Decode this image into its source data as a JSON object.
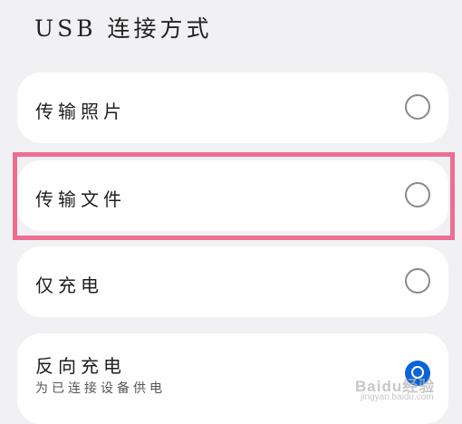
{
  "header": {
    "title": "USB 连接方式"
  },
  "options": [
    {
      "label": "传输照片",
      "selected": false
    },
    {
      "label": "传输文件",
      "selected": false
    },
    {
      "label": "仅充电",
      "selected": false
    }
  ],
  "reverse_charge": {
    "label": "反向充电",
    "description": "为已连接设备供电",
    "enabled": false
  },
  "watermark": {
    "text": "Baidu经验",
    "url": "jingyan.baidu.com"
  },
  "colors": {
    "background": "#f1f1f3",
    "card": "#ffffff",
    "highlight": "#ec6e92",
    "accent": "#0a63d9",
    "radio_border": "#8a8a8a"
  }
}
